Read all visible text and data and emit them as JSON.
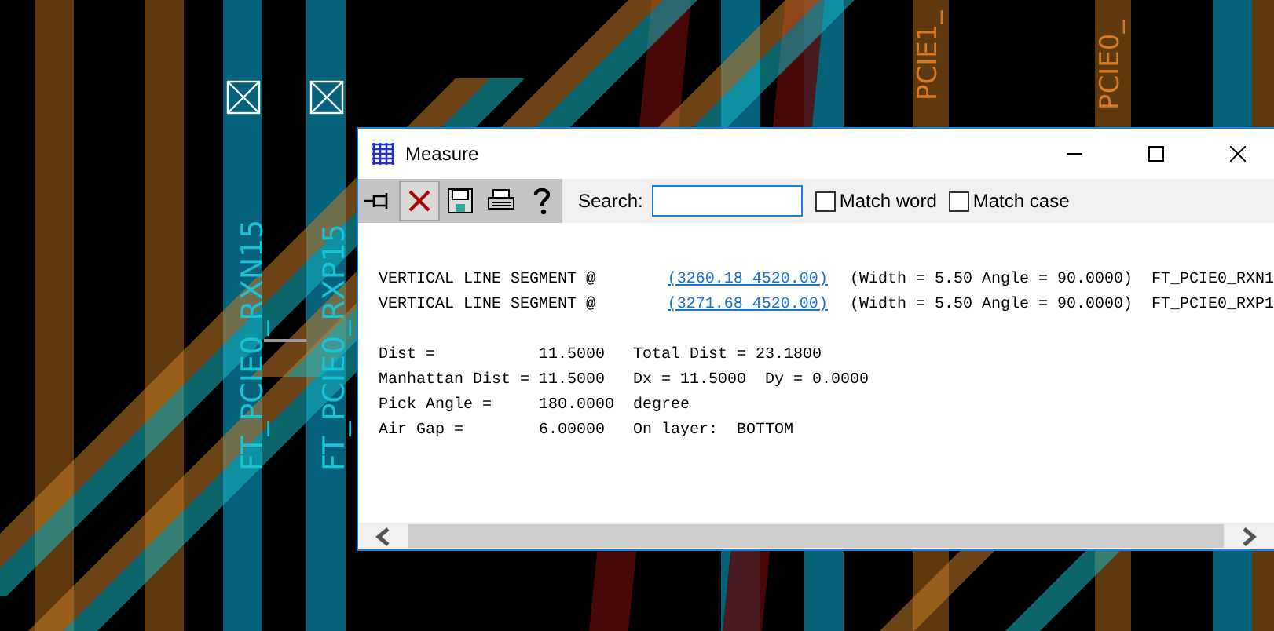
{
  "board": {
    "labels": [
      {
        "text": "FT_PCIE0_RXN15",
        "color": "#19c3d6"
      },
      {
        "text": "FT_PCIE0_RXP15",
        "color": "#19c3d6"
      },
      {
        "text": "PCIE1_",
        "color": "#d77a24"
      },
      {
        "text": "PCIE0_",
        "color": "#d77a24"
      }
    ]
  },
  "window": {
    "title": "Measure"
  },
  "search": {
    "label": "Search:"
  },
  "options": [
    {
      "label": "Match word",
      "checked": false
    },
    {
      "label": "Match case",
      "checked": false
    }
  ],
  "segments": [
    {
      "prefix": "VERTICAL LINE SEGMENT @",
      "coords": "(3260.18 4520.00)",
      "details": "(Width = 5.50 Angle = 90.0000)  FT_PCIE0_RXN1"
    },
    {
      "prefix": "VERTICAL LINE SEGMENT @",
      "coords": "(3271.68 4520.00)",
      "details": "(Width = 5.50 Angle = 90.0000)  FT_PCIE0_RXP1"
    }
  ],
  "results": [
    "Dist =           11.5000   Total Dist = 23.1800",
    "Manhattan Dist = 11.5000   Dx = 11.5000  Dy = 0.0000",
    "Pick Angle =     180.0000  degree",
    "Air Gap =        6.00000   On layer:  BOTTOM"
  ]
}
